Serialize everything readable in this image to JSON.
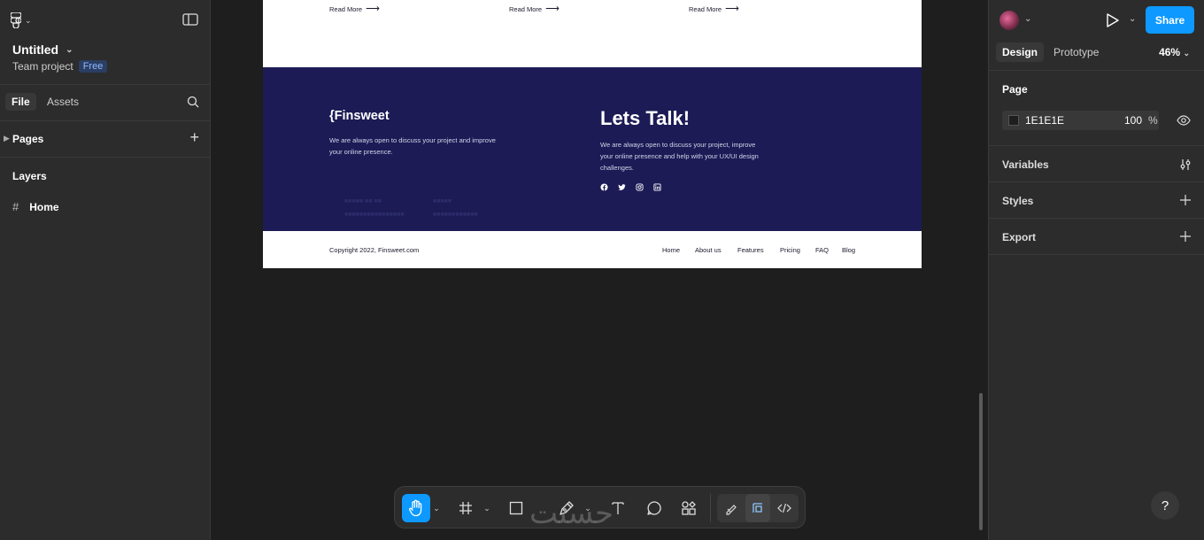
{
  "left_panel": {
    "file_title": "Untitled",
    "team": "Team project",
    "plan_badge": "Free",
    "tabs": {
      "file": "File",
      "assets": "Assets"
    },
    "pages_label": "Pages",
    "layers_label": "Layers",
    "layers": [
      {
        "name": "Home"
      }
    ]
  },
  "right_panel": {
    "share_label": "Share",
    "tabs": {
      "design": "Design",
      "prototype": "Prototype"
    },
    "zoom": "46%",
    "page_section": "Page",
    "page_color": "1E1E1E",
    "page_opacity": "100",
    "percent_sign": "%",
    "sections": {
      "variables": "Variables",
      "styles": "Styles",
      "export": "Export"
    },
    "help": "?"
  },
  "canvas": {
    "read_more": [
      "Read More",
      "Read More",
      "Read More"
    ],
    "footer": {
      "logo": "{Finsweet",
      "description": "We are always open to discuss your project and improve your online presence.",
      "talk_title": "Lets Talk!",
      "talk_description": "We are always open to discuss your project, improve your online presence and help with your UX/UI design challenges.",
      "copyright": "Copyright 2022, Finsweet.com",
      "nav": [
        "Home",
        "About us",
        "Features",
        "Pricing",
        "FAQ",
        "Blog"
      ]
    }
  },
  "watermark_text": "حسنت",
  "colors": {
    "accent": "#0d99ff",
    "footer_bg": "#1c1b56",
    "canvas_bg": "#1e1e1e",
    "panel_bg": "#2c2c2c"
  }
}
